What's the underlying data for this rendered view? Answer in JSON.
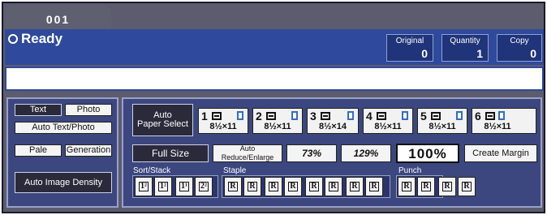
{
  "header": {
    "counter": "001",
    "status": "Ready"
  },
  "counters": [
    {
      "label": "Original",
      "value": "0"
    },
    {
      "label": "Quantity",
      "value": "1"
    },
    {
      "label": "Copy",
      "value": "0"
    }
  ],
  "left_panel": {
    "text": "Text",
    "photo": "Photo",
    "auto_text_photo": "Auto Text/Photo",
    "pale": "Pale",
    "generation": "Generation",
    "auto_image_density": "Auto Image Density"
  },
  "paper_select": {
    "auto": "Auto\nPaper Select",
    "trays": [
      {
        "num": "1",
        "size": "8½×11"
      },
      {
        "num": "2",
        "size": "8½×11"
      },
      {
        "num": "3",
        "size": "8½×14"
      },
      {
        "num": "4",
        "size": "8½×11"
      },
      {
        "num": "5",
        "size": "8½×11"
      },
      {
        "num": "6",
        "size": "8½×11"
      }
    ]
  },
  "reduce_enlarge": {
    "full_size": "Full Size",
    "auto_reduce_enlarge": "Auto Reduce/Enlarge",
    "r73": "73%",
    "r129": "129%",
    "current": "100%",
    "create_margin": "Create Margin"
  },
  "finishing": {
    "sort_stack": "Sort/Stack",
    "staple": "Staple",
    "punch": "Punch"
  }
}
